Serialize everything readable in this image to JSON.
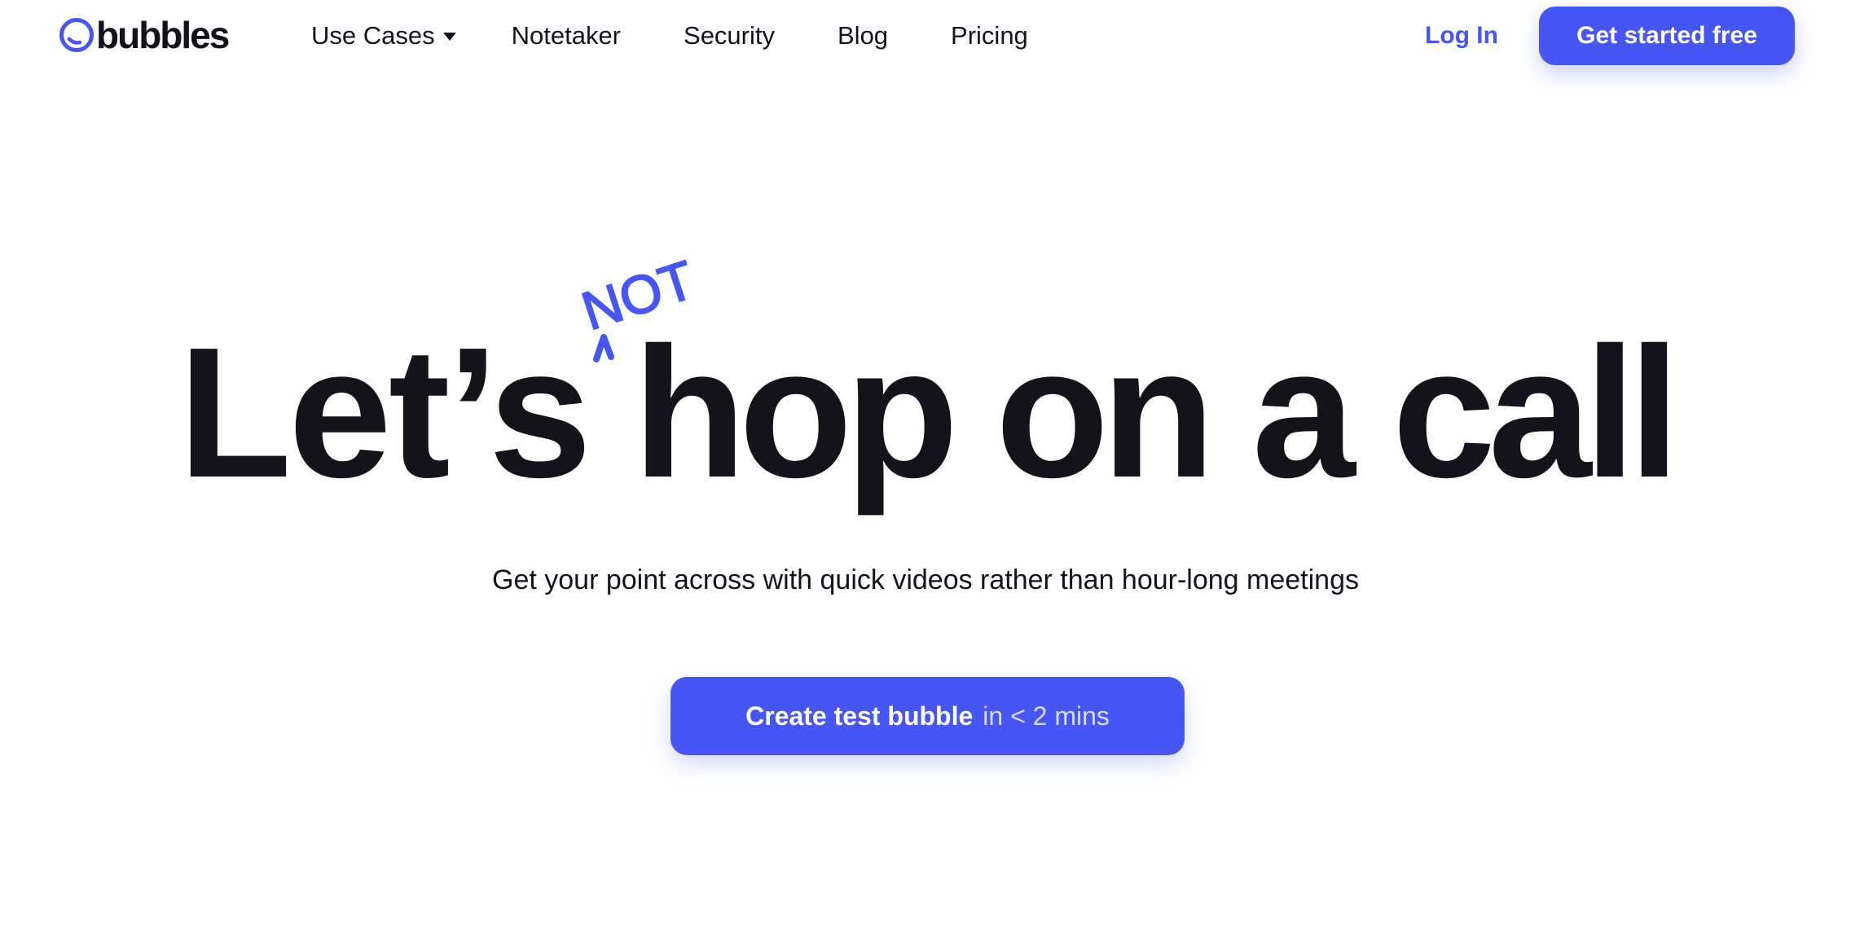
{
  "brand": {
    "name": "bubbles",
    "accent_color": "#4656f5",
    "text_color": "#14131c"
  },
  "nav": {
    "links": [
      {
        "label": "Use Cases",
        "has_dropdown": true
      },
      {
        "label": "Notetaker"
      },
      {
        "label": "Security"
      },
      {
        "label": "Blog"
      },
      {
        "label": "Pricing"
      }
    ],
    "login_label": "Log In",
    "cta_label": "Get started free"
  },
  "hero": {
    "headline_part1": "Let’s",
    "headline_part2": "hop on a call",
    "annotation": "NOT",
    "subtitle": "Get your point across with quick videos rather than hour-long meetings",
    "cta_strong": "Create test bubble",
    "cta_light": "in < 2 mins"
  }
}
